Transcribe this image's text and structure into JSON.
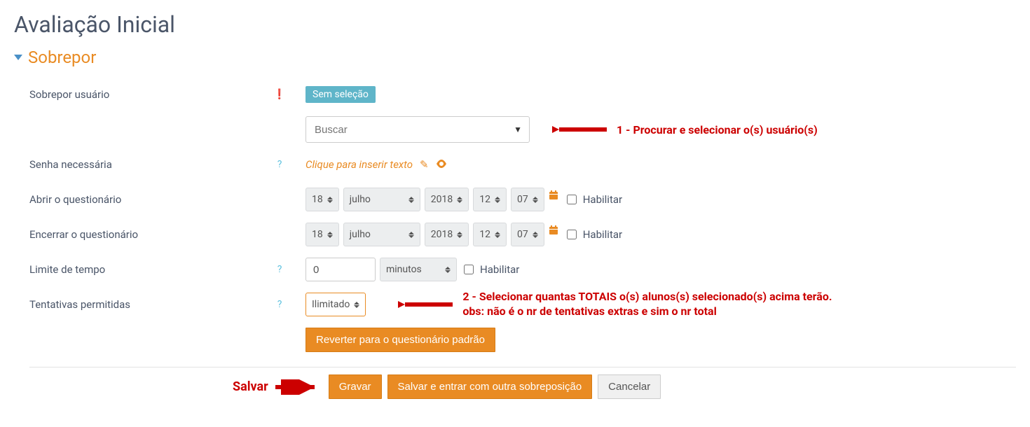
{
  "page": {
    "title": "Avaliação Inicial"
  },
  "section": {
    "title": "Sobrepor"
  },
  "labels": {
    "override_user": "Sobrepor usuário",
    "password": "Senha necessária",
    "open_quiz": "Abrir o questionário",
    "close_quiz": "Encerrar o questionário",
    "time_limit": "Limite de tempo",
    "attempts": "Tentativas permitidas"
  },
  "user_select": {
    "tag": "Sem seleção",
    "placeholder": "Buscar"
  },
  "password_field": {
    "placeholder": "Clique para inserir texto"
  },
  "open_date": {
    "day": "18",
    "month": "julho",
    "year": "2018",
    "hour": "12",
    "minute": "07",
    "enable_label": "Habilitar"
  },
  "close_date": {
    "day": "18",
    "month": "julho",
    "year": "2018",
    "hour": "12",
    "minute": "07",
    "enable_label": "Habilitar"
  },
  "time_limit": {
    "value": "0",
    "unit": "minutos",
    "enable_label": "Habilitar"
  },
  "attempts": {
    "value": "Ilimitado"
  },
  "buttons": {
    "revert": "Reverter para o questionário padrão",
    "save": "Gravar",
    "save_and_new": "Salvar e entrar com outra sobreposição",
    "cancel": "Cancelar"
  },
  "annotations": {
    "a1": "1 - Procurar e selecionar o(s) usuário(s)",
    "a2_line1": "2 - Selecionar quantas TOTAIS o(s) alunos(s) selecionado(s) acima terão.",
    "a2_line2": "obs: não é o nr de tentativas extras e sim o nr total",
    "save": "Salvar"
  }
}
